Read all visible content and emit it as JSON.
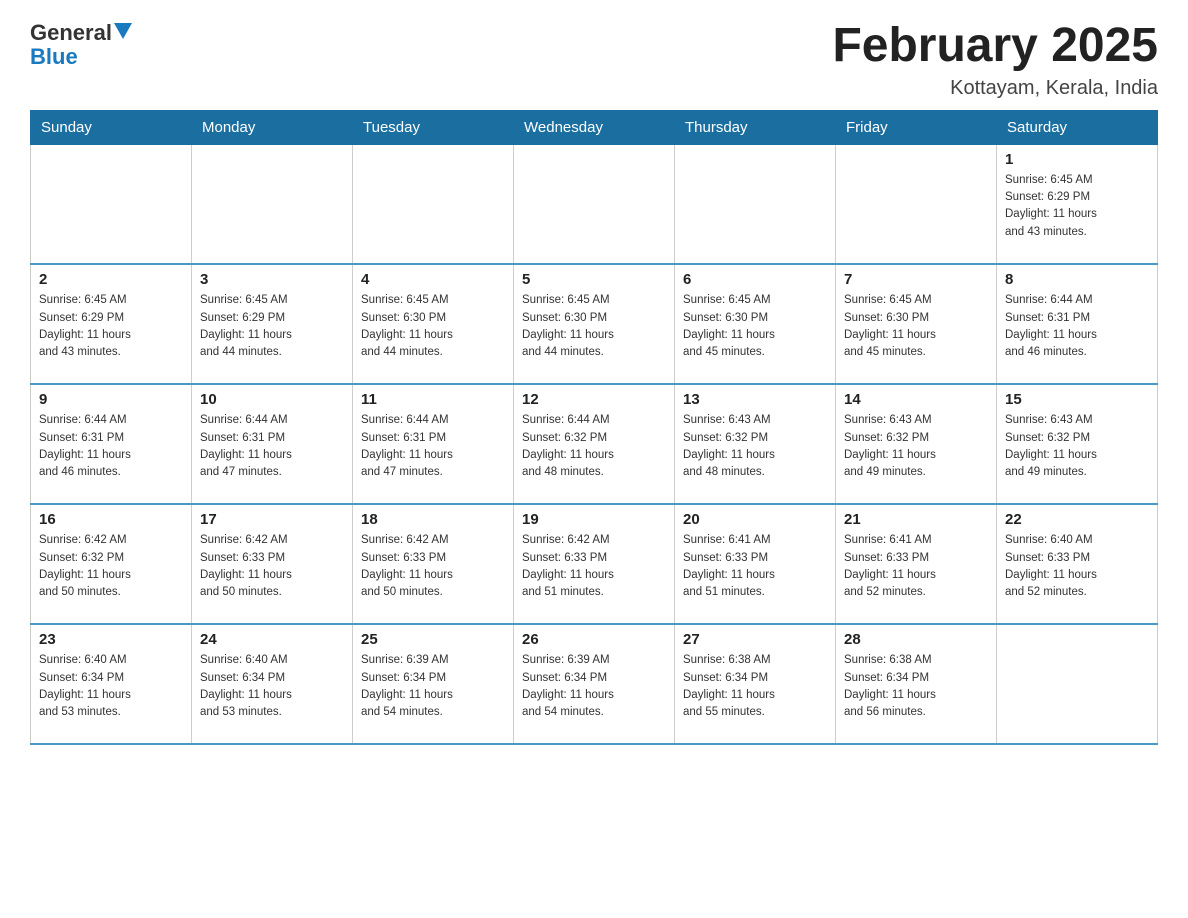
{
  "header": {
    "logo_general": "General",
    "logo_blue": "Blue",
    "title": "February 2025",
    "location": "Kottayam, Kerala, India"
  },
  "days_of_week": [
    "Sunday",
    "Monday",
    "Tuesday",
    "Wednesday",
    "Thursday",
    "Friday",
    "Saturday"
  ],
  "weeks": [
    [
      {
        "day": "",
        "info": ""
      },
      {
        "day": "",
        "info": ""
      },
      {
        "day": "",
        "info": ""
      },
      {
        "day": "",
        "info": ""
      },
      {
        "day": "",
        "info": ""
      },
      {
        "day": "",
        "info": ""
      },
      {
        "day": "1",
        "info": "Sunrise: 6:45 AM\nSunset: 6:29 PM\nDaylight: 11 hours\nand 43 minutes."
      }
    ],
    [
      {
        "day": "2",
        "info": "Sunrise: 6:45 AM\nSunset: 6:29 PM\nDaylight: 11 hours\nand 43 minutes."
      },
      {
        "day": "3",
        "info": "Sunrise: 6:45 AM\nSunset: 6:29 PM\nDaylight: 11 hours\nand 44 minutes."
      },
      {
        "day": "4",
        "info": "Sunrise: 6:45 AM\nSunset: 6:30 PM\nDaylight: 11 hours\nand 44 minutes."
      },
      {
        "day": "5",
        "info": "Sunrise: 6:45 AM\nSunset: 6:30 PM\nDaylight: 11 hours\nand 44 minutes."
      },
      {
        "day": "6",
        "info": "Sunrise: 6:45 AM\nSunset: 6:30 PM\nDaylight: 11 hours\nand 45 minutes."
      },
      {
        "day": "7",
        "info": "Sunrise: 6:45 AM\nSunset: 6:30 PM\nDaylight: 11 hours\nand 45 minutes."
      },
      {
        "day": "8",
        "info": "Sunrise: 6:44 AM\nSunset: 6:31 PM\nDaylight: 11 hours\nand 46 minutes."
      }
    ],
    [
      {
        "day": "9",
        "info": "Sunrise: 6:44 AM\nSunset: 6:31 PM\nDaylight: 11 hours\nand 46 minutes."
      },
      {
        "day": "10",
        "info": "Sunrise: 6:44 AM\nSunset: 6:31 PM\nDaylight: 11 hours\nand 47 minutes."
      },
      {
        "day": "11",
        "info": "Sunrise: 6:44 AM\nSunset: 6:31 PM\nDaylight: 11 hours\nand 47 minutes."
      },
      {
        "day": "12",
        "info": "Sunrise: 6:44 AM\nSunset: 6:32 PM\nDaylight: 11 hours\nand 48 minutes."
      },
      {
        "day": "13",
        "info": "Sunrise: 6:43 AM\nSunset: 6:32 PM\nDaylight: 11 hours\nand 48 minutes."
      },
      {
        "day": "14",
        "info": "Sunrise: 6:43 AM\nSunset: 6:32 PM\nDaylight: 11 hours\nand 49 minutes."
      },
      {
        "day": "15",
        "info": "Sunrise: 6:43 AM\nSunset: 6:32 PM\nDaylight: 11 hours\nand 49 minutes."
      }
    ],
    [
      {
        "day": "16",
        "info": "Sunrise: 6:42 AM\nSunset: 6:32 PM\nDaylight: 11 hours\nand 50 minutes."
      },
      {
        "day": "17",
        "info": "Sunrise: 6:42 AM\nSunset: 6:33 PM\nDaylight: 11 hours\nand 50 minutes."
      },
      {
        "day": "18",
        "info": "Sunrise: 6:42 AM\nSunset: 6:33 PM\nDaylight: 11 hours\nand 50 minutes."
      },
      {
        "day": "19",
        "info": "Sunrise: 6:42 AM\nSunset: 6:33 PM\nDaylight: 11 hours\nand 51 minutes."
      },
      {
        "day": "20",
        "info": "Sunrise: 6:41 AM\nSunset: 6:33 PM\nDaylight: 11 hours\nand 51 minutes."
      },
      {
        "day": "21",
        "info": "Sunrise: 6:41 AM\nSunset: 6:33 PM\nDaylight: 11 hours\nand 52 minutes."
      },
      {
        "day": "22",
        "info": "Sunrise: 6:40 AM\nSunset: 6:33 PM\nDaylight: 11 hours\nand 52 minutes."
      }
    ],
    [
      {
        "day": "23",
        "info": "Sunrise: 6:40 AM\nSunset: 6:34 PM\nDaylight: 11 hours\nand 53 minutes."
      },
      {
        "day": "24",
        "info": "Sunrise: 6:40 AM\nSunset: 6:34 PM\nDaylight: 11 hours\nand 53 minutes."
      },
      {
        "day": "25",
        "info": "Sunrise: 6:39 AM\nSunset: 6:34 PM\nDaylight: 11 hours\nand 54 minutes."
      },
      {
        "day": "26",
        "info": "Sunrise: 6:39 AM\nSunset: 6:34 PM\nDaylight: 11 hours\nand 54 minutes."
      },
      {
        "day": "27",
        "info": "Sunrise: 6:38 AM\nSunset: 6:34 PM\nDaylight: 11 hours\nand 55 minutes."
      },
      {
        "day": "28",
        "info": "Sunrise: 6:38 AM\nSunset: 6:34 PM\nDaylight: 11 hours\nand 56 minutes."
      },
      {
        "day": "",
        "info": ""
      }
    ]
  ]
}
